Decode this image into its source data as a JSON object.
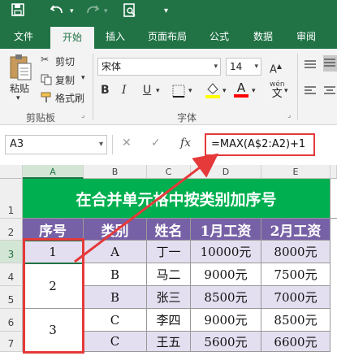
{
  "qat": {
    "save_icon": "save-icon",
    "undo_icon": "undo-icon",
    "redo_icon": "redo-icon",
    "preview_icon": "print-preview-icon",
    "customize_icon": "customize-icon"
  },
  "tabs": [
    "文件",
    "开始",
    "插入",
    "页面布局",
    "公式",
    "数据",
    "审阅"
  ],
  "ribbon": {
    "paste": "粘贴",
    "cut": "剪切",
    "copy": "复制",
    "format_painter": "格式刷",
    "clipboard_group": "剪贴板",
    "font_name": "宋体",
    "font_size": "14",
    "bold": "B",
    "italic": "I",
    "underline": "U",
    "font_group": "字体",
    "wen": "wén",
    "wen_char": "文"
  },
  "formula_bar": {
    "name_box": "A3",
    "cancel": "✕",
    "enter": "✓",
    "fx": "fx",
    "formula": "=MAX(A$2:A2)+1"
  },
  "columns": [
    "A",
    "B",
    "C",
    "D",
    "E"
  ],
  "rows": [
    "1",
    "2",
    "3",
    "4",
    "5",
    "6",
    "7"
  ],
  "sheet": {
    "title": "在合并单元格中按类别加序号",
    "headers": [
      "序号",
      "类别",
      "姓名",
      "1月工资",
      "2月工资"
    ],
    "serials": [
      "1",
      "2",
      "3"
    ],
    "data": [
      [
        "A",
        "丁一",
        "10000元",
        "8000元"
      ],
      [
        "B",
        "马二",
        "9000元",
        "7500元"
      ],
      [
        "B",
        "张三",
        "8500元",
        "7000元"
      ],
      [
        "C",
        "李四",
        "9000元",
        "8500元"
      ],
      [
        "C",
        "王五",
        "5600元",
        "6600元"
      ]
    ]
  },
  "colors": {
    "excel_green": "#217346",
    "title_bg": "#00b050",
    "header_bg": "#7761a6",
    "row_alt": "#e4dff0",
    "highlight_red": "#e5393a"
  }
}
